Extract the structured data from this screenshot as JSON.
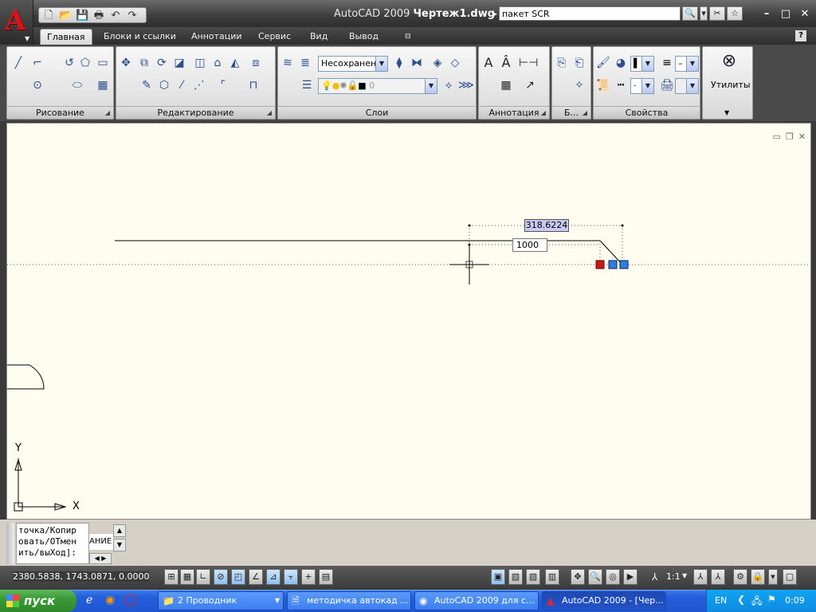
{
  "app": {
    "title_prefix": "AutoCAD 2009",
    "title_file": "Чертеж1.dwg",
    "search_value": "пакет SCR"
  },
  "tabs": [
    "Главная",
    "Блоки и ссылки",
    "Аннотации",
    "Сервис",
    "Вид",
    "Вывод"
  ],
  "panels": {
    "draw": "Рисование",
    "modify": "Редактирование",
    "layers": "Слои",
    "annotation": "Аннотация",
    "blocks": "Б...",
    "properties": "Свойства",
    "utilities": "Утилиты"
  },
  "layer_state": "Несохранен",
  "current_layer": "0",
  "drawing": {
    "dim_label": "318.6224",
    "input_value": "1000",
    "axis_x": "X",
    "axis_y": "Y"
  },
  "command": {
    "lines": [
      "точка/Копир",
      "овать/ОТмен",
      "ить/выХод]:"
    ],
    "side": "АНИЕ"
  },
  "status": {
    "coords": "2380.5838, 1743.0871, 0.0000",
    "scale": "1:1"
  },
  "taskbar": {
    "start": "пуск",
    "items": [
      "2 Проводник",
      "методичка автокад ...",
      "AutoCAD 2009 для с...",
      "AutoCAD 2009 - [Чер..."
    ],
    "lang": "EN",
    "time": "0:09"
  }
}
